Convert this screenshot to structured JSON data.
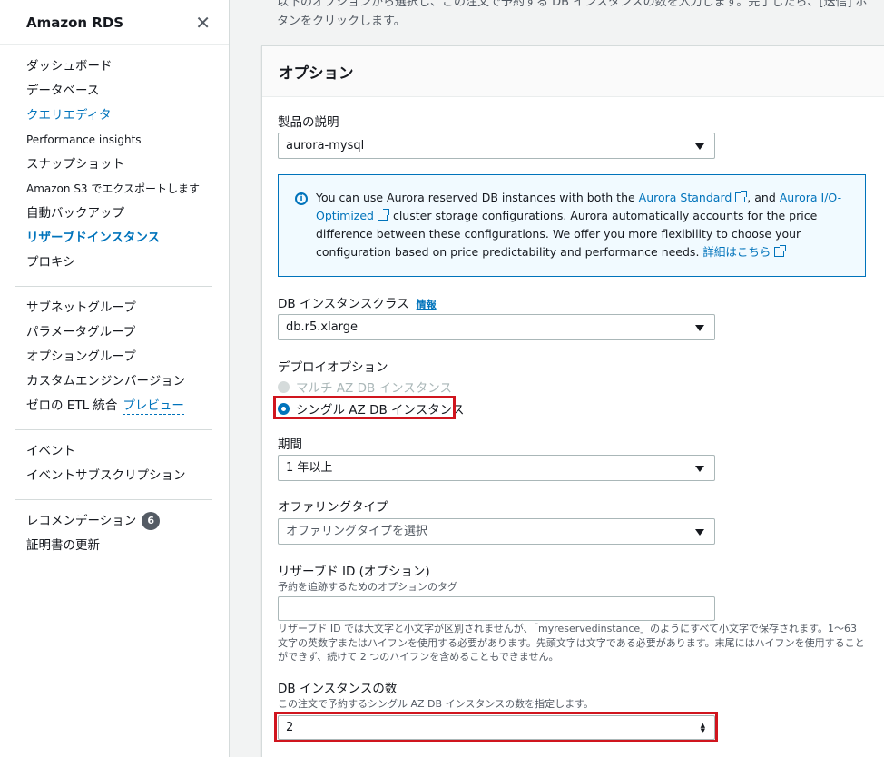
{
  "sidebar": {
    "title": "Amazon RDS",
    "group1": [
      {
        "label": "ダッシュボード",
        "style": ""
      },
      {
        "label": "データベース",
        "style": ""
      },
      {
        "label": "クエリエディタ",
        "style": "active-blue"
      },
      {
        "label": "Performance insights",
        "style": "small"
      },
      {
        "label": "スナップショット",
        "style": ""
      },
      {
        "label": "Amazon S3 でエクスポートします",
        "style": "small"
      },
      {
        "label": "自動バックアップ",
        "style": ""
      },
      {
        "label": "リザーブドインスタンス",
        "style": "active-bold"
      },
      {
        "label": "プロキシ",
        "style": ""
      }
    ],
    "group2": [
      {
        "label": "サブネットグループ"
      },
      {
        "label": "パラメータグループ"
      },
      {
        "label": "オプショングループ"
      },
      {
        "label": "カスタムエンジンバージョン"
      }
    ],
    "zero_etl": {
      "label": "ゼロの ETL 統合",
      "preview": "プレビュー"
    },
    "group3": [
      {
        "label": "イベント"
      },
      {
        "label": "イベントサブスクリプション"
      }
    ],
    "recommendations": {
      "label": "レコメンデーション",
      "count": "6"
    },
    "cert_update": "証明書の更新"
  },
  "intro_text": "以下のオプションから選択し、この注文で予約する DB インスタンスの数を入力します。完了したら、[送信] ボタンをクリックします。",
  "panel": {
    "title": "オプション",
    "product": {
      "label": "製品の説明",
      "value": "aurora-mysql"
    },
    "alert": {
      "t1": "You can use Aurora reserved DB instances with both the ",
      "link1": "Aurora Standard",
      "t2": ", and ",
      "link2": "Aurora I/O-Optimized",
      "t3": " cluster storage configurations. Aurora automatically accounts for the price difference between these configurations. We offer you more flexibility to choose your configuration based on price predictability and performance needs. ",
      "link3": "詳細はこちら"
    },
    "instance_class": {
      "label": "DB インスタンスクラス",
      "info": "情報",
      "value": "db.r5.xlarge"
    },
    "deploy": {
      "label": "デプロイオプション",
      "multi_az": "マルチ AZ DB インスタンス",
      "single_az": "シングル AZ DB インスタンス"
    },
    "term": {
      "label": "期間",
      "value": "1 年以上"
    },
    "offering": {
      "label": "オファリングタイプ",
      "placeholder": "オファリングタイプを選択"
    },
    "reserved_id": {
      "label": "リザーブド ID (オプション)",
      "sublabel": "予約を追跡するためのオプションのタグ",
      "value": "",
      "help": "リザーブド ID では大文字と小文字が区別されませんが、「myreservedinstance」のようにすべて小文字で保存されます。1～63 文字の英数字またはハイフンを使用する必要があります。先頭文字は文字である必要があります。末尾にはハイフンを使用することができず、続けて 2 つのハイフンを含めることもできません。"
    },
    "count": {
      "label": "DB インスタンスの数",
      "sublabel": "この注文で予約するシングル AZ DB インスタンスの数を指定します。",
      "value": "2"
    }
  },
  "colors": {
    "accent": "#0073bb",
    "highlight": "#d0151e"
  }
}
